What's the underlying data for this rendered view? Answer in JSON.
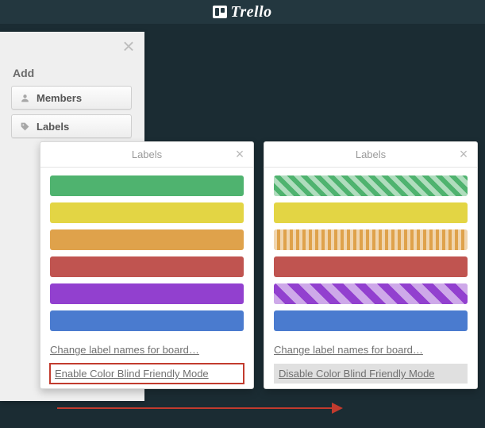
{
  "app": {
    "name": "Trello"
  },
  "sidebar": {
    "add_heading": "Add",
    "members_label": "Members",
    "labels_label": "Labels"
  },
  "popover": {
    "title": "Labels",
    "change_names": "Change label names for board…",
    "enable_cb": "Enable Color Blind Friendly Mode",
    "disable_cb": "Disable Color Blind Friendly Mode"
  },
  "colors": {
    "green": "#4fb36f",
    "yellow": "#e3d544",
    "orange": "#dfa24b",
    "red": "#c05450",
    "purple": "#9240cf",
    "blue": "#4a7bcf"
  }
}
